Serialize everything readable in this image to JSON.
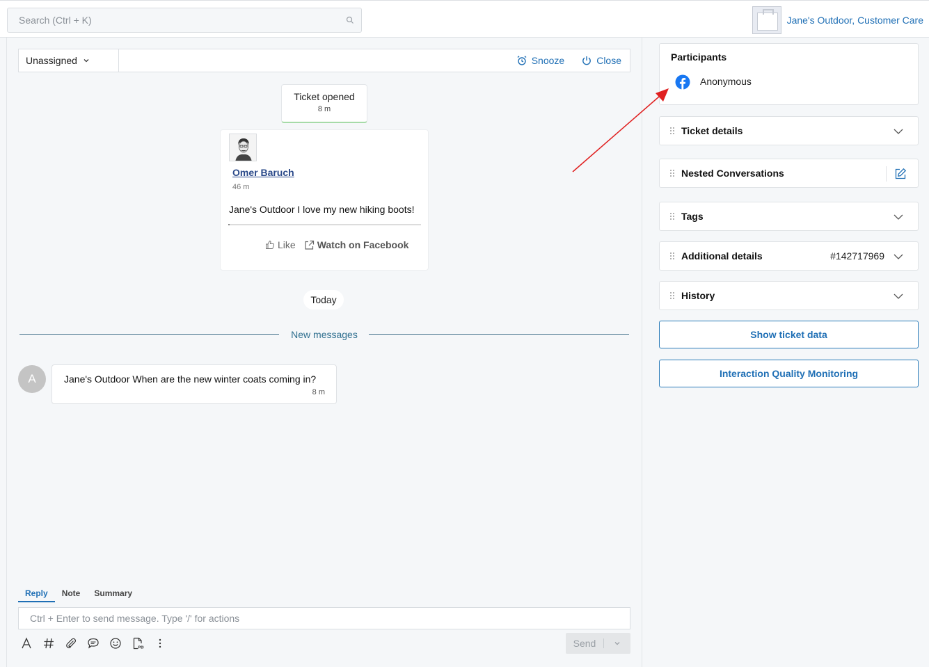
{
  "header": {
    "search_placeholder": "Search (Ctrl + K)",
    "brand_name": "Jane's Outdoor, Customer Care"
  },
  "ticket_bar": {
    "assignee": "Unassigned",
    "snooze_label": "Snooze",
    "close_label": "Close"
  },
  "events": {
    "ticket_opened_label": "Ticket opened",
    "ticket_opened_time": "8 m"
  },
  "post": {
    "author": "Omer Baruch",
    "time": "46 m",
    "text": "Jane's Outdoor I love my new hiking boots!",
    "like_label": "Like",
    "watch_label": "Watch on Facebook"
  },
  "today_label": "Today",
  "new_messages_label": "New messages",
  "message": {
    "avatar_initial": "A",
    "text": "Jane's Outdoor When are the new winter coats coming in?",
    "time": "8 m"
  },
  "composer": {
    "tabs": [
      {
        "label": "Reply",
        "active": true
      },
      {
        "label": "Note",
        "active": false
      },
      {
        "label": "Summary",
        "active": false
      }
    ],
    "placeholder": "Ctrl + Enter to send message. Type '/' for actions",
    "send_label": "Send",
    "tools": [
      "text-format-icon",
      "hashtag-icon",
      "attachment-icon",
      "canned-response-icon",
      "emoji-icon",
      "pdf-icon",
      "more-icon"
    ]
  },
  "right_panel": {
    "participants_title": "Participants",
    "participant_name": "Anonymous",
    "sections": {
      "ticket_details": "Ticket details",
      "nested_conversations": "Nested Conversations",
      "tags": "Tags",
      "additional_details": "Additional details",
      "additional_details_id": "#142717969",
      "history": "History"
    },
    "show_ticket_data_label": "Show ticket data",
    "iqm_label": "Interaction Quality Monitoring"
  },
  "colors": {
    "accent": "#1f6fb5",
    "facebook": "#1877f2",
    "annotation_arrow": "#e02020",
    "opened_border": "#a6dba8"
  }
}
